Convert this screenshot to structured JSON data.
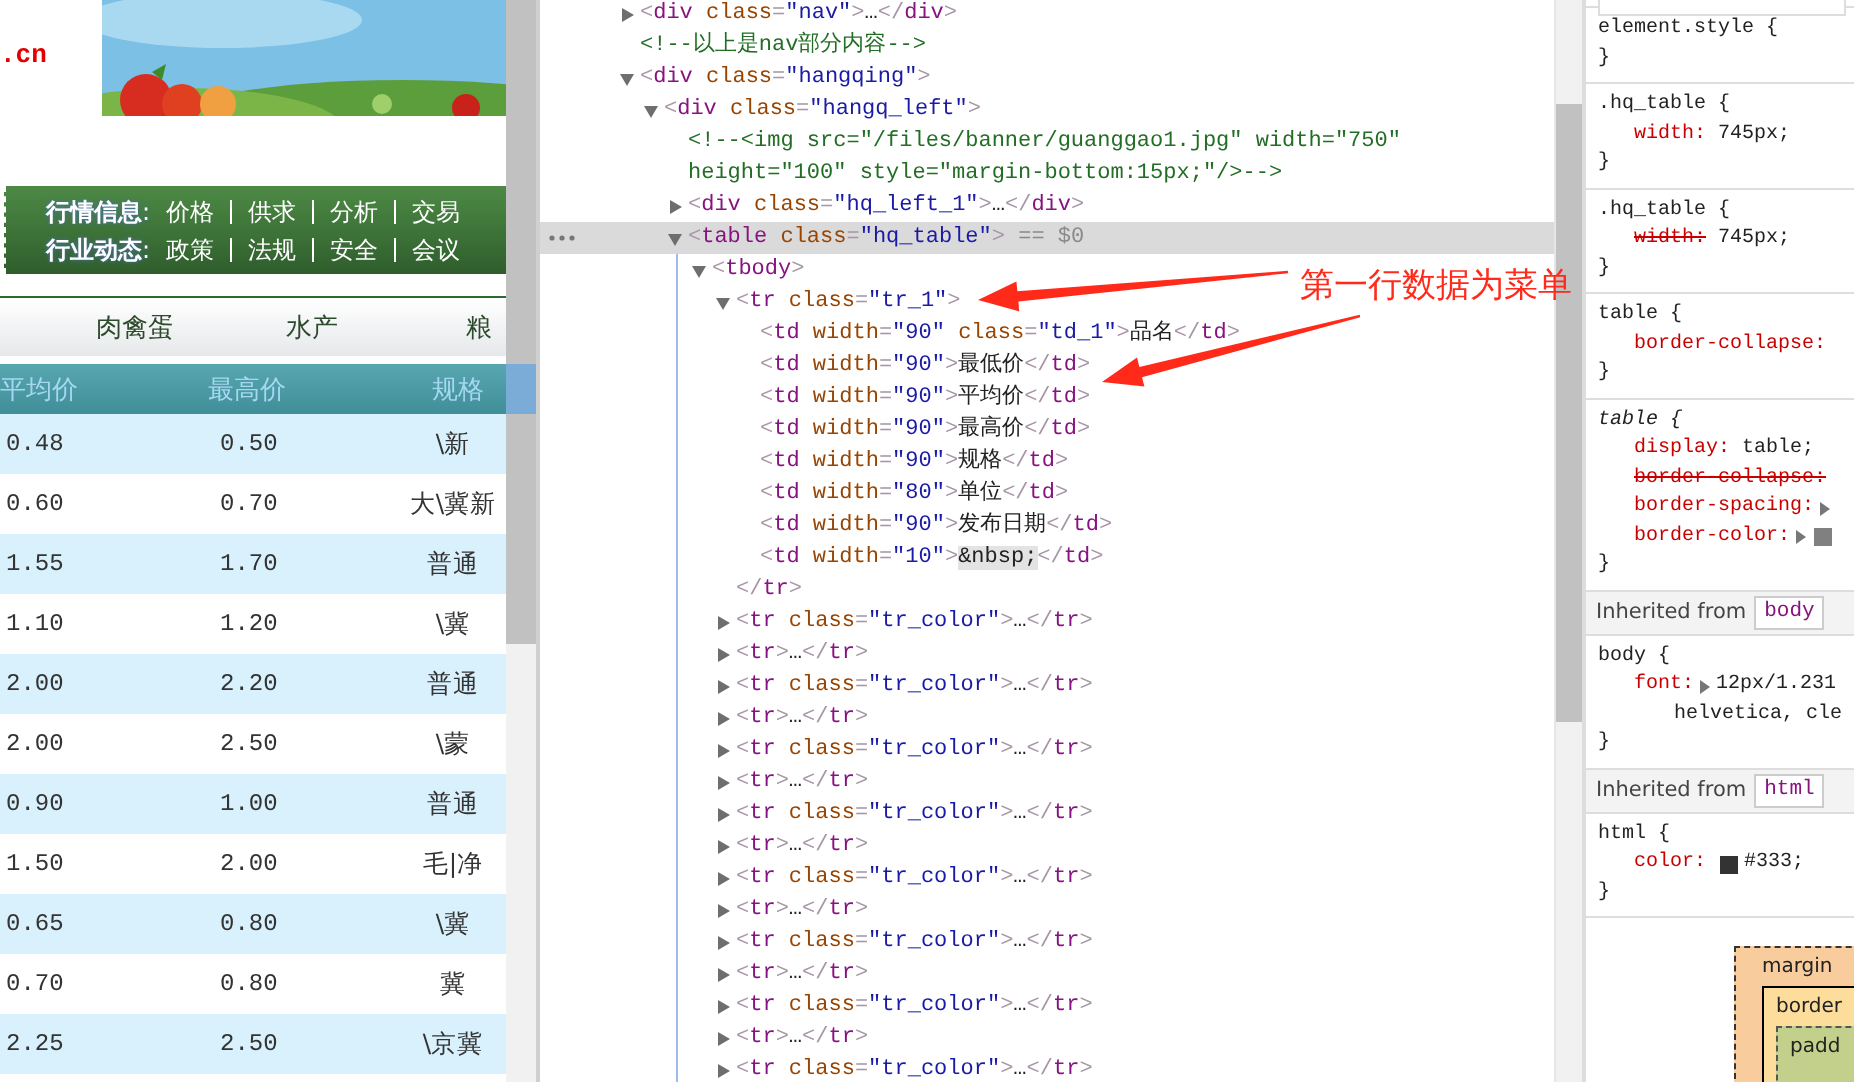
{
  "page_preview": {
    "logo_text": ".cn",
    "nav_rows": [
      {
        "heading": "**行情信息**:",
        "links": [
          "价格",
          "供求",
          "分析",
          "交易"
        ]
      },
      {
        "heading": "**行业动态**:",
        "links": [
          "政策",
          "法规",
          "安全",
          "会议"
        ]
      }
    ],
    "categories": [
      "肉禽蛋",
      "水产",
      "粮"
    ],
    "price_table": {
      "columns": [
        "平均价",
        "最高价",
        "规格"
      ],
      "rows": [
        [
          "0.48",
          "0.50",
          "\\新"
        ],
        [
          "0.60",
          "0.70",
          "大\\冀新"
        ],
        [
          "1.55",
          "1.70",
          "普通"
        ],
        [
          "1.10",
          "1.20",
          "\\冀"
        ],
        [
          "2.00",
          "2.20",
          "普通"
        ],
        [
          "2.00",
          "2.50",
          "\\蒙"
        ],
        [
          "0.90",
          "1.00",
          "普通"
        ],
        [
          "1.50",
          "2.00",
          "毛|净"
        ],
        [
          "0.65",
          "0.80",
          "\\冀"
        ],
        [
          "0.70",
          "0.80",
          "冀"
        ],
        [
          "2.25",
          "2.50",
          "\\京冀"
        ]
      ]
    }
  },
  "dom_tree": [
    {
      "markup": "<div class=\"nav\">…</div>",
      "kind": "element",
      "expanded": false,
      "selected": false
    },
    {
      "markup": "<!--以上是nav部分内容-->",
      "kind": "comment",
      "selected": false
    },
    {
      "markup": "<div class=\"hangqing\">",
      "kind": "element",
      "expanded": true,
      "selected": false,
      "children": [
        {
          "markup": "<div class=\"hangq_left\">",
          "kind": "element",
          "expanded": true,
          "selected": false,
          "children": [
            {
              "markup": "<!--<img src=\"/files/banner/guanggao1.jpg\" width=\"750\" height=\"100\" style=\"margin-bottom:15px;\"/>-->",
              "kind": "comment",
              "selected": false
            },
            {
              "markup": "<div class=\"hq_left_1\">…</div>",
              "kind": "element",
              "expanded": false,
              "selected": false
            },
            {
              "markup": "<table class=\"hq_table\">",
              "note": "== $0",
              "kind": "element",
              "expanded": true,
              "selected": true,
              "children": [
                {
                  "markup": "<tbody>",
                  "kind": "element",
                  "expanded": true,
                  "selected": false,
                  "children": [
                    {
                      "markup": "<tr class=\"tr_1\">",
                      "kind": "element",
                      "expanded": true,
                      "selected": false,
                      "closing": "</tr>",
                      "children": [
                        {
                          "markup": "<td width=\"90\" class=\"td_1\">品名</td>",
                          "kind": "element",
                          "selected": false
                        },
                        {
                          "markup": "<td width=\"90\">最低价</td>",
                          "kind": "element",
                          "selected": false
                        },
                        {
                          "markup": "<td width=\"90\">平均价</td>",
                          "kind": "element",
                          "selected": false
                        },
                        {
                          "markup": "<td width=\"90\">最高价</td>",
                          "kind": "element",
                          "selected": false
                        },
                        {
                          "markup": "<td width=\"90\">规格</td>",
                          "kind": "element",
                          "selected": false
                        },
                        {
                          "markup": "<td width=\"80\">单位</td>",
                          "kind": "element",
                          "selected": false
                        },
                        {
                          "markup": "<td width=\"90\">发布日期</td>",
                          "kind": "element",
                          "selected": false
                        },
                        {
                          "markup": "<td width=\"10\">&nbsp;</td>",
                          "kind": "element",
                          "selected": false
                        }
                      ]
                    },
                    {
                      "markup": "<tr class=\"tr_color\">…</tr>",
                      "kind": "element",
                      "expanded": false,
                      "selected": false
                    },
                    {
                      "markup": "<tr>…</tr>",
                      "kind": "element",
                      "expanded": false,
                      "selected": false
                    },
                    {
                      "markup": "<tr class=\"tr_color\">…</tr>",
                      "kind": "element",
                      "expanded": false,
                      "selected": false
                    },
                    {
                      "markup": "<tr>…</tr>",
                      "kind": "element",
                      "expanded": false,
                      "selected": false
                    },
                    {
                      "markup": "<tr class=\"tr_color\">…</tr>",
                      "kind": "element",
                      "expanded": false,
                      "selected": false
                    },
                    {
                      "markup": "<tr>…</tr>",
                      "kind": "element",
                      "expanded": false,
                      "selected": false
                    },
                    {
                      "markup": "<tr class=\"tr_color\">…</tr>",
                      "kind": "element",
                      "expanded": false,
                      "selected": false
                    },
                    {
                      "markup": "<tr>…</tr>",
                      "kind": "element",
                      "expanded": false,
                      "selected": false
                    },
                    {
                      "markup": "<tr class=\"tr_color\">…</tr>",
                      "kind": "element",
                      "expanded": false,
                      "selected": false
                    },
                    {
                      "markup": "<tr>…</tr>",
                      "kind": "element",
                      "expanded": false,
                      "selected": false
                    },
                    {
                      "markup": "<tr class=\"tr_color\">…</tr>",
                      "kind": "element",
                      "expanded": false,
                      "selected": false
                    },
                    {
                      "markup": "<tr>…</tr>",
                      "kind": "element",
                      "expanded": false,
                      "selected": false
                    },
                    {
                      "markup": "<tr class=\"tr_color\">…</tr>",
                      "kind": "element",
                      "expanded": false,
                      "selected": false
                    },
                    {
                      "markup": "<tr>…</tr>",
                      "kind": "element",
                      "expanded": false,
                      "selected": false
                    },
                    {
                      "markup": "<tr class=\"tr_color\">…</tr>",
                      "kind": "element",
                      "expanded": false,
                      "selected": false
                    }
                  ]
                }
              ]
            }
          ]
        }
      ]
    }
  ],
  "styles_pane": {
    "blocks": [
      {
        "kind": "rule",
        "selector": "element.style {",
        "close": "}",
        "user_agent": false
      },
      {
        "kind": "rule",
        "selector": ".hq_table {",
        "close": "}",
        "user_agent": false,
        "declarations": [
          {
            "prop": "width:",
            "value": "745px;",
            "overridden": false
          }
        ]
      },
      {
        "kind": "rule",
        "selector": ".hq_table {",
        "close": "}",
        "user_agent": false,
        "declarations": [
          {
            "prop": "width:",
            "value": "745px;",
            "overridden": true
          }
        ]
      },
      {
        "kind": "rule",
        "selector": "table {",
        "close": "}",
        "user_agent": false,
        "declarations": [
          {
            "prop": "border-collapse:",
            "overridden": false
          }
        ]
      },
      {
        "kind": "rule",
        "selector": "table {",
        "close": "}",
        "user_agent": true,
        "declarations": [
          {
            "prop": "display:",
            "value": "table;",
            "overridden": false
          },
          {
            "prop": "border-collapse:",
            "overridden": true
          },
          {
            "prop": "border-spacing:",
            "overridden": false,
            "expandable": true
          },
          {
            "prop": "border-color:",
            "overridden": false,
            "expandable": true,
            "color": "#808080"
          }
        ]
      },
      {
        "kind": "inherited",
        "label": "Inherited from",
        "source": "body"
      },
      {
        "kind": "rule",
        "selector": "body {",
        "close": "}",
        "user_agent": false,
        "declarations": [
          {
            "prop": "font:",
            "value": "12px/1.231",
            "continuation": "helvetica, cle",
            "overridden": false,
            "expandable": true
          }
        ]
      },
      {
        "kind": "inherited",
        "label": "Inherited from",
        "source": "html"
      },
      {
        "kind": "rule",
        "selector": "html {",
        "close": "}",
        "user_agent": false,
        "declarations": [
          {
            "prop": "color:",
            "value": "#333;",
            "overridden": false,
            "color": "#333333"
          }
        ]
      }
    ],
    "box_model": {
      "margin": "margin",
      "border": "border",
      "padding": "padd"
    }
  },
  "annotation": {
    "text": "第一行数据为菜单"
  }
}
